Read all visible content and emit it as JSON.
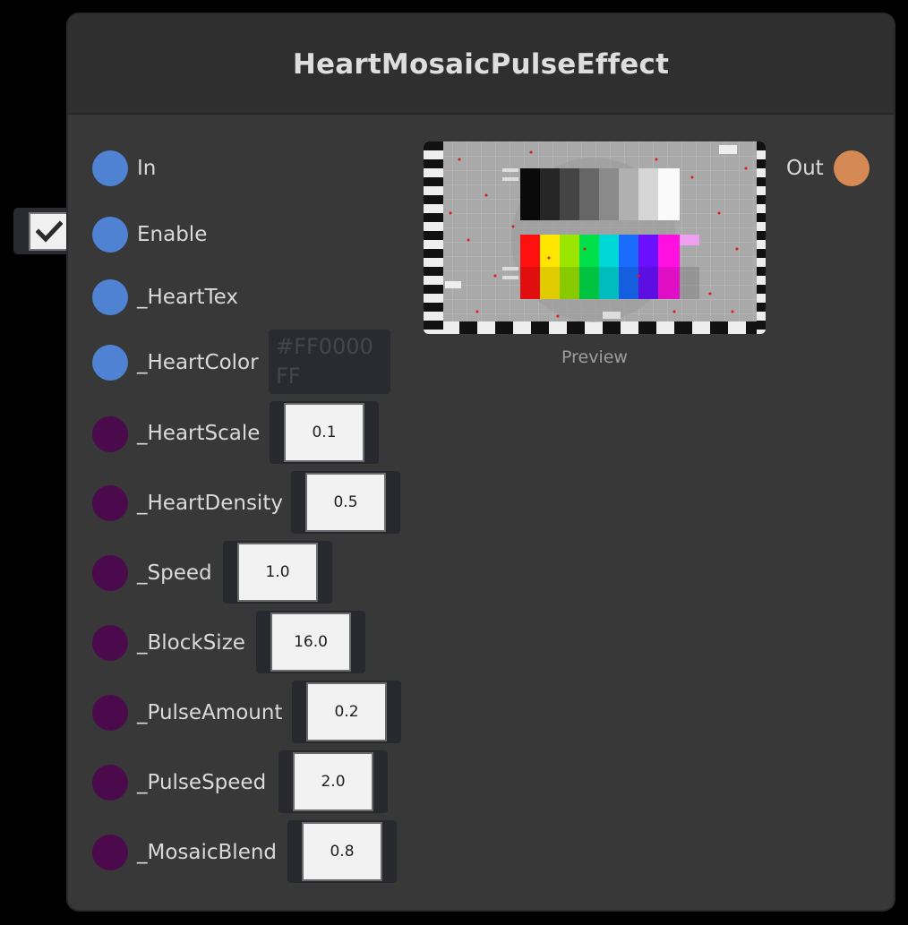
{
  "node": {
    "title": "HeartMosaicPulseEffect",
    "preview_label": "Preview",
    "colors": {
      "body": "#383838",
      "header": "#2f2f2f",
      "port_texture": "#4f82d2",
      "port_float": "#4b0a4b",
      "port_out": "#d58a55"
    }
  },
  "ports": {
    "in": {
      "label": "In",
      "type": "texture"
    },
    "enable": {
      "label": "Enable",
      "type": "bool",
      "checked": true,
      "icon": "checkmark-icon"
    },
    "heart_tex": {
      "label": "_HeartTex",
      "type": "texture"
    },
    "heart_color": {
      "label": "_HeartColor",
      "type": "color",
      "value": "#FF0000FF"
    },
    "heart_scale": {
      "label": "_HeartScale",
      "type": "float",
      "value": "0.1"
    },
    "heart_density": {
      "label": "_HeartDensity",
      "type": "float",
      "value": "0.5"
    },
    "speed": {
      "label": "_Speed",
      "type": "float",
      "value": "1.0"
    },
    "block_size": {
      "label": "_BlockSize",
      "type": "float",
      "value": "16.0"
    },
    "pulse_amount": {
      "label": "_PulseAmount",
      "type": "float",
      "value": "0.2"
    },
    "pulse_speed": {
      "label": "_PulseSpeed",
      "type": "float",
      "value": "2.0"
    },
    "mosaic_blend": {
      "label": "_MosaicBlend",
      "type": "float",
      "value": "0.8"
    },
    "out": {
      "label": "Out",
      "type": "texture"
    }
  }
}
